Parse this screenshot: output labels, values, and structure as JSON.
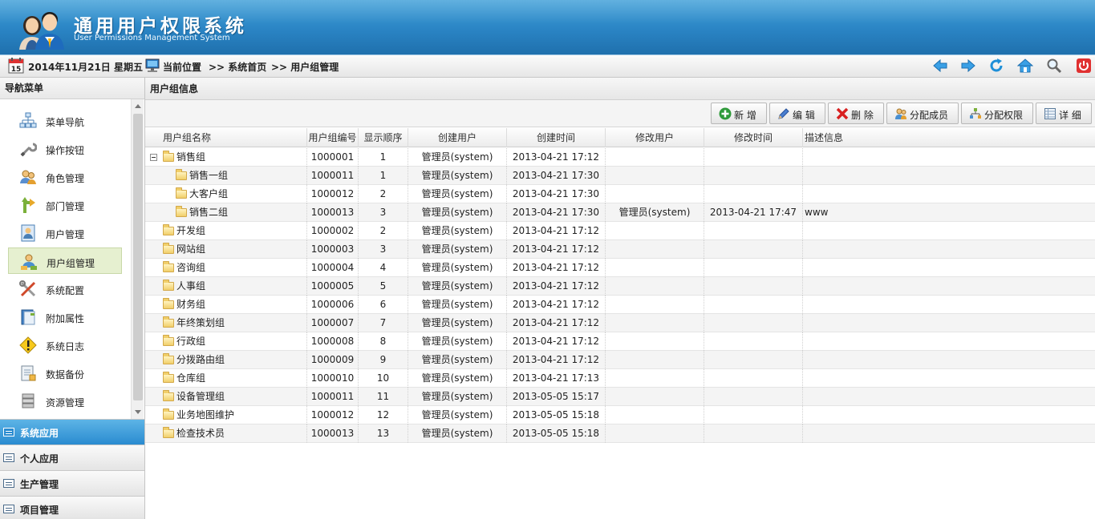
{
  "app": {
    "title_cn": "通用用户权限系统",
    "title_en": "User Permissions Management System"
  },
  "toolbar": {
    "date_text": "2014年11月21日 星期五",
    "calendar_day": "15",
    "location_label": "当前位置",
    "crumb1": ">> 系统首页",
    "crumb2": ">> 用户组管理",
    "icons": [
      "back-arrow-icon",
      "forward-arrow-icon",
      "refresh-icon",
      "home-icon",
      "search-icon",
      "power-icon"
    ]
  },
  "sidebar": {
    "title": "导航菜单",
    "items": [
      {
        "label": "菜单导航",
        "icon": "sitemap-icon"
      },
      {
        "label": "操作按钮",
        "icon": "wrench-icon"
      },
      {
        "label": "角色管理",
        "icon": "users-icon"
      },
      {
        "label": "部门管理",
        "icon": "branch-arrow-icon"
      },
      {
        "label": "用户管理",
        "icon": "user-card-icon"
      },
      {
        "label": "用户组管理",
        "icon": "user-group-icon"
      },
      {
        "label": "系统配置",
        "icon": "tools-icon"
      },
      {
        "label": "附加属性",
        "icon": "book-icon"
      },
      {
        "label": "系统日志",
        "icon": "warning-icon"
      },
      {
        "label": "数据备份",
        "icon": "backup-doc-icon"
      },
      {
        "label": "资源管理",
        "icon": "database-icon"
      }
    ],
    "active_index": 5,
    "sections": [
      {
        "label": "系统应用",
        "active": true
      },
      {
        "label": "个人应用",
        "active": false
      },
      {
        "label": "生产管理",
        "active": false
      },
      {
        "label": "项目管理",
        "active": false
      }
    ]
  },
  "panel": {
    "title": "用户组信息",
    "buttons": [
      {
        "label": "新 增",
        "icon": "add-icon"
      },
      {
        "label": "编 辑",
        "icon": "edit-icon"
      },
      {
        "label": "删 除",
        "icon": "delete-icon"
      },
      {
        "label": "分配成员",
        "icon": "assign-members-icon"
      },
      {
        "label": "分配权限",
        "icon": "assign-permissions-icon"
      },
      {
        "label": "详 细",
        "icon": "details-icon"
      }
    ]
  },
  "grid": {
    "columns": [
      "用户组名称",
      "用户组编号",
      "显示顺序",
      "创建用户",
      "创建时间",
      "修改用户",
      "修改时间",
      "描述信息"
    ],
    "rows": [
      {
        "name": "销售组",
        "code": "1000001",
        "order": "1",
        "creator": "管理员(system)",
        "created": "2013-04-21 17:12",
        "modifier": "",
        "modified": "",
        "desc": "",
        "level": 0,
        "expanded": true
      },
      {
        "name": "销售一组",
        "code": "1000011",
        "order": "1",
        "creator": "管理员(system)",
        "created": "2013-04-21 17:30",
        "modifier": "",
        "modified": "",
        "desc": "",
        "level": 1
      },
      {
        "name": "大客户组",
        "code": "1000012",
        "order": "2",
        "creator": "管理员(system)",
        "created": "2013-04-21 17:30",
        "modifier": "",
        "modified": "",
        "desc": "",
        "level": 1
      },
      {
        "name": "销售二组",
        "code": "1000013",
        "order": "3",
        "creator": "管理员(system)",
        "created": "2013-04-21 17:30",
        "modifier": "管理员(system)",
        "modified": "2013-04-21 17:47",
        "desc": "www",
        "level": 1
      },
      {
        "name": "开发组",
        "code": "1000002",
        "order": "2",
        "creator": "管理员(system)",
        "created": "2013-04-21 17:12",
        "modifier": "",
        "modified": "",
        "desc": "",
        "level": 0
      },
      {
        "name": "网站组",
        "code": "1000003",
        "order": "3",
        "creator": "管理员(system)",
        "created": "2013-04-21 17:12",
        "modifier": "",
        "modified": "",
        "desc": "",
        "level": 0
      },
      {
        "name": "咨询组",
        "code": "1000004",
        "order": "4",
        "creator": "管理员(system)",
        "created": "2013-04-21 17:12",
        "modifier": "",
        "modified": "",
        "desc": "",
        "level": 0
      },
      {
        "name": "人事组",
        "code": "1000005",
        "order": "5",
        "creator": "管理员(system)",
        "created": "2013-04-21 17:12",
        "modifier": "",
        "modified": "",
        "desc": "",
        "level": 0
      },
      {
        "name": "财务组",
        "code": "1000006",
        "order": "6",
        "creator": "管理员(system)",
        "created": "2013-04-21 17:12",
        "modifier": "",
        "modified": "",
        "desc": "",
        "level": 0
      },
      {
        "name": "年终策划组",
        "code": "1000007",
        "order": "7",
        "creator": "管理员(system)",
        "created": "2013-04-21 17:12",
        "modifier": "",
        "modified": "",
        "desc": "",
        "level": 0
      },
      {
        "name": "行政组",
        "code": "1000008",
        "order": "8",
        "creator": "管理员(system)",
        "created": "2013-04-21 17:12",
        "modifier": "",
        "modified": "",
        "desc": "",
        "level": 0
      },
      {
        "name": "分拨路由组",
        "code": "1000009",
        "order": "9",
        "creator": "管理员(system)",
        "created": "2013-04-21 17:12",
        "modifier": "",
        "modified": "",
        "desc": "",
        "level": 0
      },
      {
        "name": "仓库组",
        "code": "1000010",
        "order": "10",
        "creator": "管理员(system)",
        "created": "2013-04-21 17:13",
        "modifier": "",
        "modified": "",
        "desc": "",
        "level": 0
      },
      {
        "name": "设备管理组",
        "code": "1000011",
        "order": "11",
        "creator": "管理员(system)",
        "created": "2013-05-05 15:17",
        "modifier": "",
        "modified": "",
        "desc": "",
        "level": 0
      },
      {
        "name": "业务地图维护",
        "code": "1000012",
        "order": "12",
        "creator": "管理员(system)",
        "created": "2013-05-05 15:18",
        "modifier": "",
        "modified": "",
        "desc": "",
        "level": 0
      },
      {
        "name": "检查技术员",
        "code": "1000013",
        "order": "13",
        "creator": "管理员(system)",
        "created": "2013-05-05 15:18",
        "modifier": "",
        "modified": "",
        "desc": "",
        "level": 0
      }
    ]
  },
  "colors": {
    "header_blue": "#2a84c4",
    "section_active": "#2a8bd0",
    "menu_active_bg": "#e6f0d0",
    "row_alt": "#f4f4f4"
  }
}
